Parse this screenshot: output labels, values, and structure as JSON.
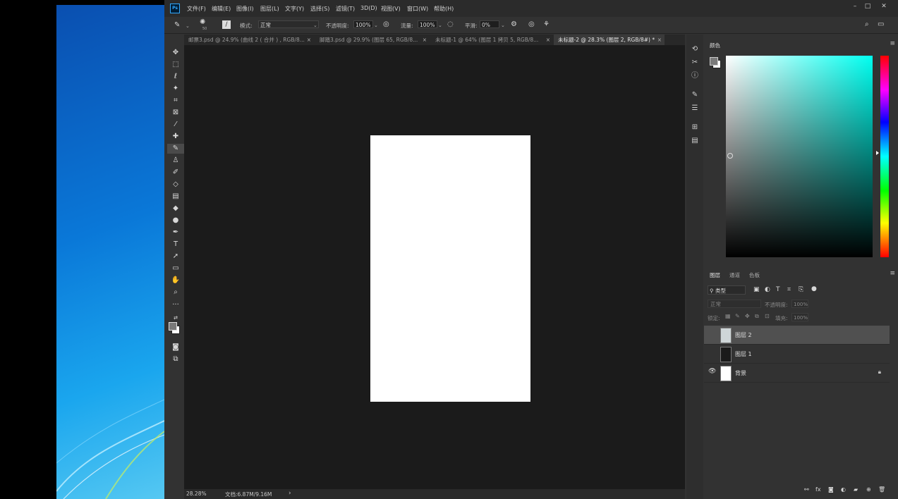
{
  "app": {
    "logo": "Ps",
    "menu": [
      "文件(F)",
      "编辑(E)",
      "图像(I)",
      "图层(L)",
      "文字(Y)",
      "选择(S)",
      "滤镜(T)",
      "3D(D)",
      "视图(V)",
      "窗口(W)",
      "帮助(H)"
    ]
  },
  "options": {
    "brush_size": "50",
    "mode_label": "模式:",
    "mode_value": "正常",
    "opacity_label": "不透明度:",
    "opacity_value": "100%",
    "flow_label": "流量:",
    "flow_value": "100%",
    "smooth_label": "平滑:",
    "smooth_value": "0%"
  },
  "tabs": [
    {
      "label": "邮票3.psd @ 24.9% (曲线 2 ( 合并 ) , RGB/8..."
    },
    {
      "label": "脚踏3.psd @ 29.9% (图层 65, RGB/8..."
    },
    {
      "label": "未标题-1 @ 64% (图层 1 拷贝 5, RGB/8..."
    },
    {
      "label": "未标题-2 @ 28.3% (图层 2, RGB/8#) *"
    }
  ],
  "status": {
    "zoom": "28.28%",
    "doc_info": "文档:6.87M/9.16M",
    "arrow": "›"
  },
  "color_panel": {
    "title": "颜色",
    "accent": "#00fff0"
  },
  "layers_panel": {
    "tabs": [
      "图层",
      "通道",
      "色板"
    ],
    "filter_value": "类型",
    "blend_value": "正常",
    "opacity_label": "不透明度:",
    "opacity_value": "100%",
    "lock_label": "锁定:",
    "fill_label": "填充:",
    "fill_value": "100%",
    "layers": [
      {
        "name": "图层 2",
        "visible": false,
        "selected": true
      },
      {
        "name": "图层 1",
        "visible": false,
        "selected": false
      },
      {
        "name": "背景",
        "visible": true,
        "selected": false,
        "locked": true
      }
    ]
  }
}
